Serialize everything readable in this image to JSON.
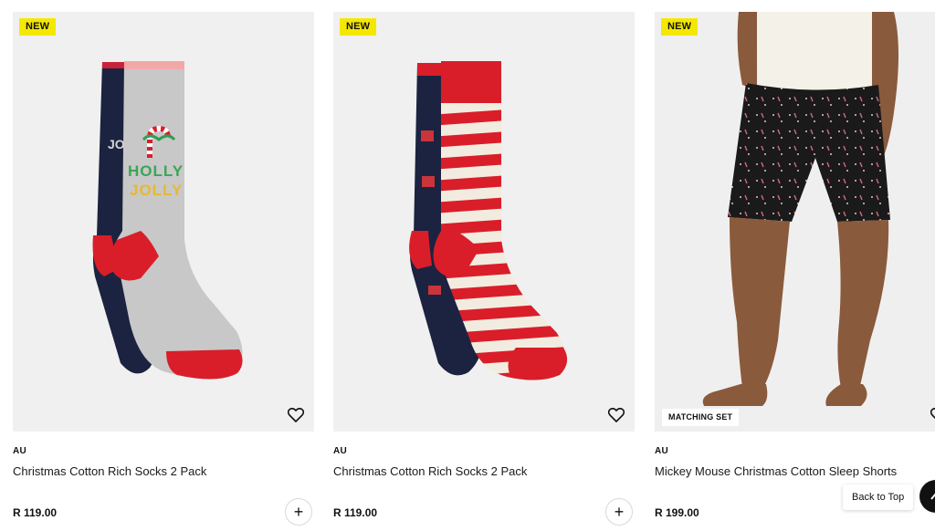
{
  "products": [
    {
      "badge": "NEW",
      "brand": "AU",
      "name": "Christmas Cotton Rich Socks 2 Pack",
      "price": "R 119.00",
      "image": "grey-holly-jolly-socks"
    },
    {
      "badge": "NEW",
      "brand": "AU",
      "name": "Christmas Cotton Rich Socks 2 Pack",
      "price": "R 119.00",
      "image": "red-striped-socks"
    },
    {
      "badge": "NEW",
      "tag": "MATCHING SET",
      "brand": "AU",
      "name": "Mickey Mouse Christmas Cotton Sleep Shorts",
      "price": "R 199.00",
      "image": "black-candy-cane-sleep-shorts"
    }
  ],
  "sock_print": {
    "line1": "HOLLY",
    "line2": "JOLLY",
    "back_print": "JO"
  },
  "back_to_top": {
    "label": "Back to Top"
  },
  "icons": {
    "wishlist": "heart-icon",
    "add": "plus-icon",
    "scroll_top": "arrow-up-icon"
  },
  "colors": {
    "badge_new": "#f5e800",
    "sock_red": "#d91e2a",
    "sock_navy": "#1c2340",
    "sock_grey": "#c8c8c8"
  }
}
